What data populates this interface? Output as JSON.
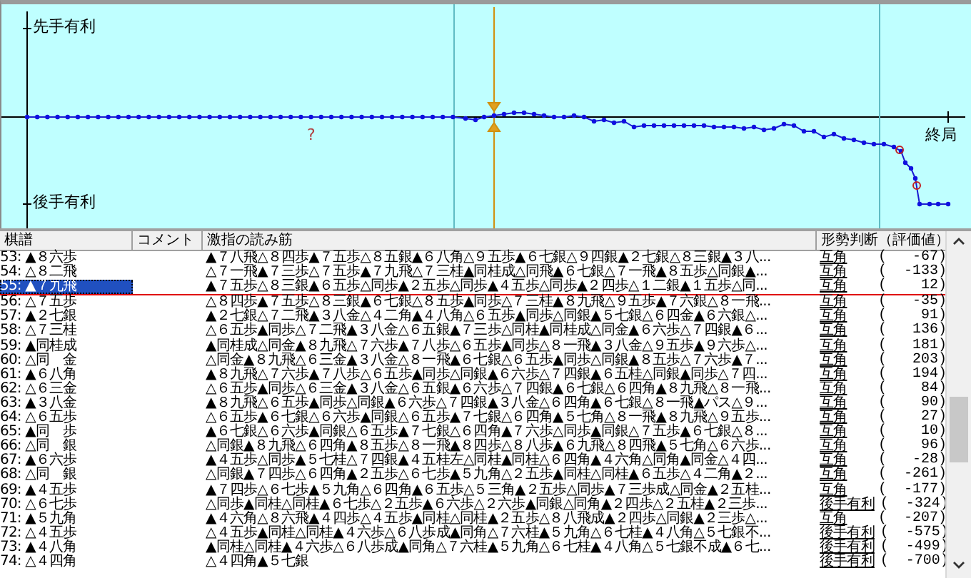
{
  "graph": {
    "top_label": "先手有利",
    "bottom_label": "後手有利",
    "end_label": "終局",
    "marker": "?"
  },
  "table": {
    "columns": [
      "棋譜",
      "コメント",
      "激指の読み筋",
      "形勢判断（評価値）"
    ],
    "rows": [
      {
        "move": "53: ▲８六歩",
        "line": "▲７八飛△８四歩▲７五歩△８五銀▲６八角△９五歩▲６七銀△９四銀▲２七銀△８三銀▲３八...",
        "judgement": "互角",
        "value": "(   -67)",
        "selected": false
      },
      {
        "move": "54: △８二飛",
        "line": "△７一飛▲７三歩△７五歩▲７九飛△７三桂▲同桂成△同飛▲６七銀△７一飛▲８五歩△同銀▲...",
        "judgement": "互角",
        "value": "(  -133)",
        "selected": false
      },
      {
        "move": "55: ▲７九飛",
        "line": "▲７五歩△８三銀▲６五歩△同歩▲２五歩△同歩▲４五歩△同歩▲２四歩△１二銀▲１五歩△同...",
        "judgement": "互角",
        "value": "(    12)",
        "selected": true
      },
      {
        "move": "56: △７五歩",
        "line": "△８四歩▲７五歩△８三銀▲６七銀△８五歩▲同歩△７三桂▲８九飛△９五歩▲７六銀△８一飛...",
        "judgement": "互角",
        "value": "(   -35)",
        "selected": false
      },
      {
        "move": "57: ▲２七銀",
        "line": "▲２七銀△７二飛▲３八金△４二角▲４八角△６五歩▲同歩△同銀▲５七銀△６四金▲６六銀△...",
        "judgement": "互角",
        "value": "(    91)",
        "selected": false
      },
      {
        "move": "58: △７三桂",
        "line": "△６五歩▲同歩△７二飛▲３八金△６五銀▲７三歩△同桂▲同桂成△同金▲６六歩△７四銀▲６...",
        "judgement": "互角",
        "value": "(   136)",
        "selected": false
      },
      {
        "move": "59: ▲同桂成",
        "line": "▲同桂成△同金▲８九飛△７六歩▲７八歩△６五歩▲同歩△８一飛▲３八金△９五歩▲９六歩△...",
        "judgement": "互角",
        "value": "(   181)",
        "selected": false
      },
      {
        "move": "60: △同　金",
        "line": "△同金▲８九飛△６三金▲３八金△８一飛▲６七銀△６五歩▲同歩△同銀▲８五歩△７六歩▲７...",
        "judgement": "互角",
        "value": "(   203)",
        "selected": false
      },
      {
        "move": "61: ▲６八角",
        "line": "▲８九飛△７六歩▲７八歩△６五歩▲同歩△同銀▲６六歩△７四銀▲６五桂△同銀▲同歩△７四...",
        "judgement": "互角",
        "value": "(   194)",
        "selected": false
      },
      {
        "move": "62: △６三金",
        "line": "△６五歩▲同歩△６三金▲３八金△６五銀▲６六歩△７四銀▲６七銀△６四角▲８九飛△８一飛...",
        "judgement": "互角",
        "value": "(    84)",
        "selected": false
      },
      {
        "move": "63: ▲３八金",
        "line": "▲８九飛△６五歩▲同歩△同銀▲６六歩△７四銀▲３八金△６四角▲６七銀△８一飛▲パス△９...",
        "judgement": "互角",
        "value": "(    90)",
        "selected": false
      },
      {
        "move": "64: △６五歩",
        "line": "△６五歩▲６七銀△６六歩▲同銀△６五歩▲７七銀△６四角▲５七角△８一飛▲８九飛△９五歩...",
        "judgement": "互角",
        "value": "(    27)",
        "selected": false
      },
      {
        "move": "65: ▲同　歩",
        "line": "▲６七銀△６六歩▲同銀△６五歩▲７七銀△６四角▲７六歩△同歩▲同銀△７五歩▲６七銀△８...",
        "judgement": "互角",
        "value": "(    10)",
        "selected": false
      },
      {
        "move": "66: △同　銀",
        "line": "△同銀▲８九飛△６四角▲８五歩△８一飛▲８四歩△８八歩▲６九飛△８四飛▲５七角△６六歩...",
        "judgement": "互角",
        "value": "(    96)",
        "selected": false
      },
      {
        "move": "67: ▲６六歩",
        "line": "▲４五歩△同歩▲５七桂△７四銀▲４五桂左△同桂▲同桂△６四角▲４六角△同角▲同金△４四...",
        "judgement": "互角",
        "value": "(   -28)",
        "selected": false
      },
      {
        "move": "68: △同　銀",
        "line": "△同銀▲７四歩△６四角▲２五歩△６七歩▲５九角△２五歩▲同桂△同桂▲６五歩△４二角▲２...",
        "judgement": "互角",
        "value": "(  -261)",
        "selected": false
      },
      {
        "move": "69: ▲４五歩",
        "line": "▲７四歩△６七歩▲５九角△６四角▲６五歩△５三角▲２五歩△同歩▲７三歩成△同金▲２五桂...",
        "judgement": "互角",
        "value": "(  -177)",
        "selected": false
      },
      {
        "move": "70: △６七歩",
        "line": "△同歩▲同桂△同桂▲６七歩△２五歩▲６六歩△２六歩▲同銀△同角▲２四歩△２五桂▲２三歩...",
        "judgement": "後手有利",
        "value": "(  -324)",
        "selected": false
      },
      {
        "move": "71: ▲５九角",
        "line": "▲４六角△８六飛▲４四歩△４五歩▲同桂△同桂▲２五歩△８八飛成▲２四歩△同銀▲２三歩△...",
        "judgement": "互角",
        "value": "(  -207)",
        "selected": false
      },
      {
        "move": "72: △４五歩",
        "line": "△４五歩▲同桂△同桂▲４六歩△６八歩成▲同角△７六桂▲５九角△６七桂▲４八角△５七銀不...",
        "judgement": "後手有利",
        "value": "(  -575)",
        "selected": false
      },
      {
        "move": "73: ▲４八角",
        "line": "▲同桂△同桂▲４六歩△６八歩成▲同角△７六桂▲５九角△６七桂▲４八角△５七銀不成▲６七...",
        "judgement": "後手有利",
        "value": "(  -499)",
        "selected": false
      },
      {
        "move": "74: △４四角",
        "line": "△４四角▲５七銀",
        "judgement": "後手有利",
        "value": "(  -700)",
        "selected": false
      }
    ]
  }
}
